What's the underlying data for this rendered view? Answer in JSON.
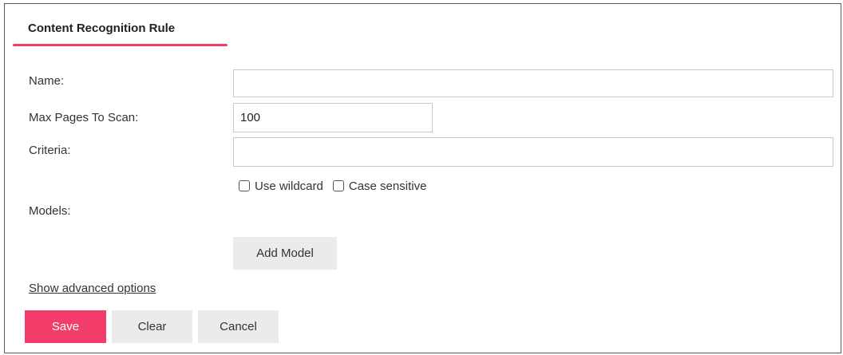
{
  "tab": {
    "title": "Content Recognition Rule"
  },
  "form": {
    "name_label": "Name:",
    "name_value": "",
    "max_pages_label": "Max Pages To Scan:",
    "max_pages_value": "100",
    "criteria_label": "Criteria:",
    "criteria_value": "",
    "use_wildcard_label": "Use wildcard",
    "use_wildcard_checked": false,
    "case_sensitive_label": "Case sensitive",
    "case_sensitive_checked": false,
    "models_label": "Models:",
    "add_model_label": "Add Model"
  },
  "advanced_link": "Show advanced options",
  "actions": {
    "save_label": "Save",
    "clear_label": "Clear",
    "cancel_label": "Cancel"
  },
  "colors": {
    "accent": "#f23d6a",
    "button_grey": "#ebebeb",
    "border": "#c8c8c8"
  }
}
